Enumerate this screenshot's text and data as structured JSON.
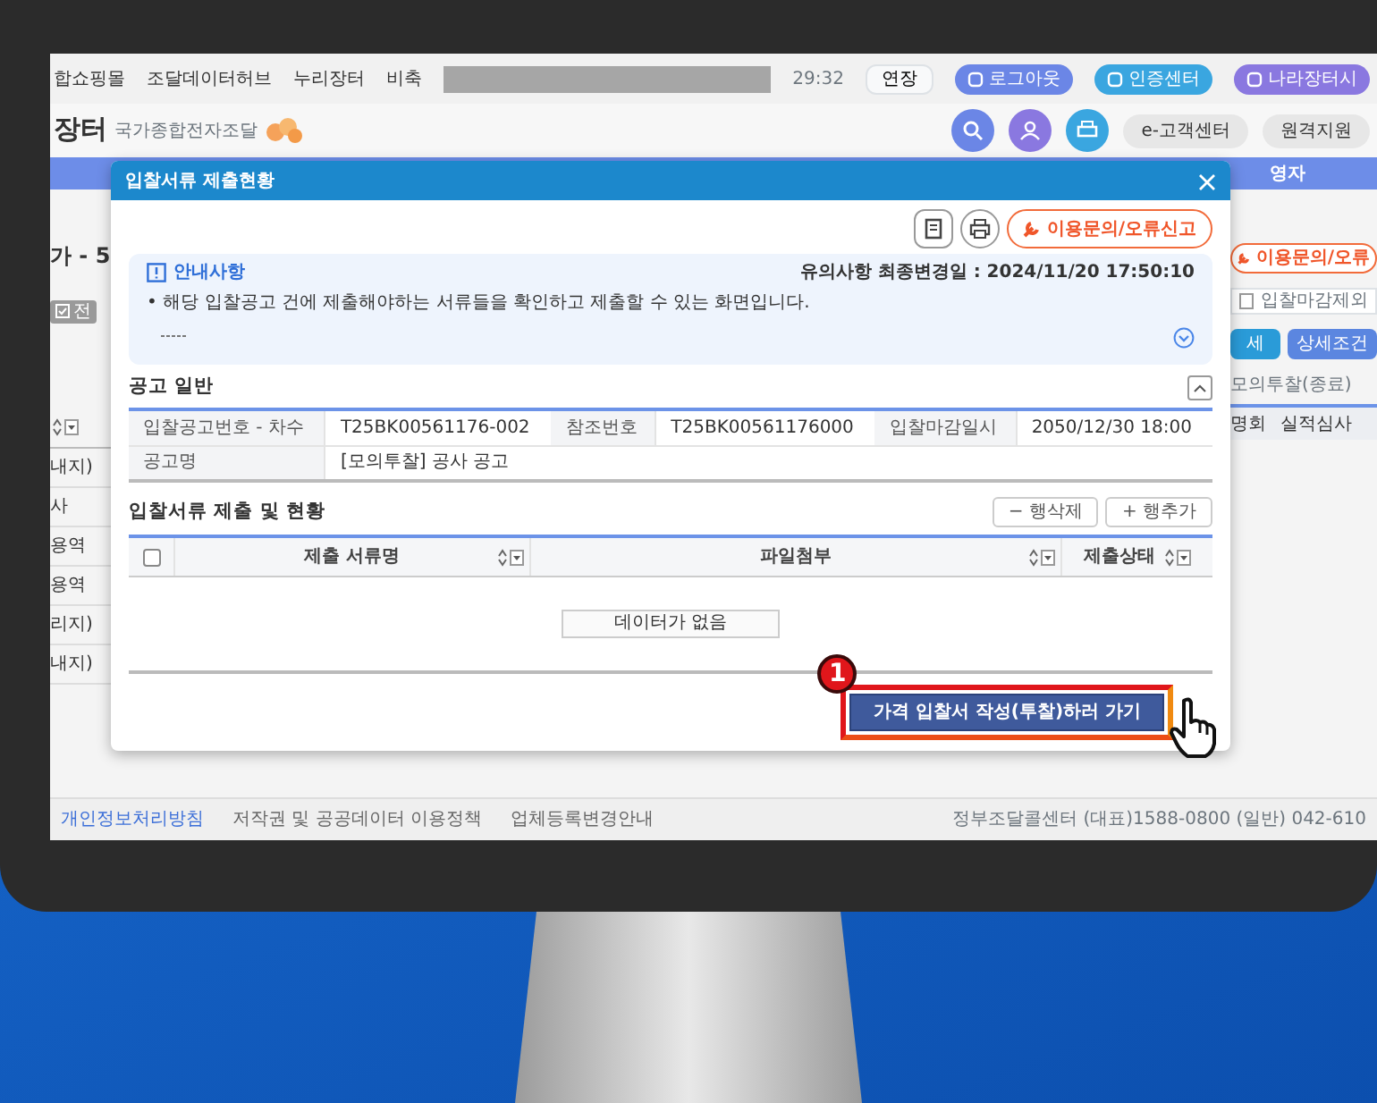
{
  "background_page": {
    "top_menu": [
      "합쇼핑몰",
      "조달데이터허브",
      "누리장터",
      "비축"
    ],
    "session_time": "29:32",
    "extend_button": "연장",
    "top_buttons": [
      {
        "label": "로그아웃",
        "color": "#6b86e6"
      },
      {
        "label": "인증센터",
        "color": "#3aa6e0"
      },
      {
        "label": "나라장터시",
        "color": "#8a78e0"
      }
    ],
    "logo_text": "장터",
    "logo_subtitle": "국가종합전자조달",
    "header_links": [
      "e-고객센터",
      "원격지원"
    ],
    "band_text": "영자",
    "page_title": "가 - 5",
    "filter_chip": "전",
    "left_rows": [
      "내지)",
      "사",
      "용역",
      "용역",
      "리지)",
      "내지)"
    ],
    "help_button": "이용문의/오류",
    "deadline_filter": {
      "label": "입찰마감제외",
      "checked": false
    },
    "search_button": "세",
    "detail_button": "상세조건",
    "mock_link": "모의투찰(종료)",
    "columns": [
      "명회",
      "실적심사"
    ],
    "footer_links": [
      "개인정보처리방침",
      "저작권 및 공공데이터 이용정책",
      "업체등록변경안내"
    ],
    "footer_contact": "정부조달콜센터 (대표)1588-0800 (일반) 042-610"
  },
  "dialog": {
    "title": "입찰서류 제출현황",
    "help_button": "이용문의/오류신고",
    "notice": {
      "title": "안내사항",
      "updated": "유의사항 최종변경일 : 2024/11/20 17:50:10",
      "text": "• 해당 입찰공고 건에 제출해야하는 서류들을 확인하고 제출할 수 있는 화면입니다.",
      "expanded": false
    },
    "general": {
      "title": "공고 일반",
      "expanded": true,
      "rows": [
        [
          {
            "label": "입찰공고번호 - 차수",
            "value": "T25BK00561176-002"
          },
          {
            "label": "참조번호",
            "value": "T25BK00561176000"
          },
          {
            "label": "입찰마감일시",
            "value": "2050/12/30 18:00"
          }
        ],
        [
          {
            "label": "공고명",
            "value": "[모의투찰] 공사 공고"
          }
        ]
      ]
    },
    "documents": {
      "title": "입찰서류 제출 및 현황",
      "buttons": [
        "− 행삭제",
        "+ 행추가"
      ],
      "columns": [
        "제출 서류명",
        "파일첨부",
        "제출상태"
      ],
      "all_checked": false,
      "empty_text": "데이터가 없음"
    },
    "submit_button": "가격 입찰서 작성(투찰)하러 가기",
    "step_badge": "1"
  }
}
